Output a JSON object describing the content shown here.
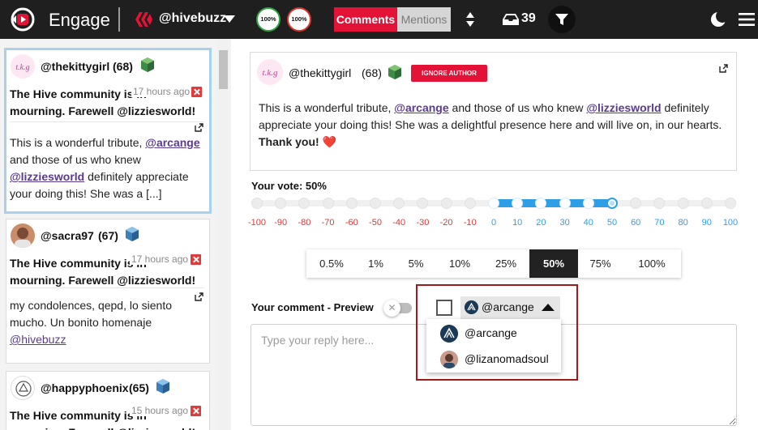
{
  "app": {
    "title": "Engage"
  },
  "header": {
    "account": "@hivebuzz",
    "voting_power": "100%",
    "resource_credits": "100%",
    "tabs": [
      {
        "label": "Comments",
        "active": true
      },
      {
        "label": "Mentions",
        "active": false
      }
    ],
    "inbox_count": "39",
    "icons": [
      "engage-logo-icon",
      "hive-logo-icon",
      "sort-icon",
      "inbox-icon",
      "filter-icon",
      "moon-icon",
      "menu-icon"
    ]
  },
  "colors": {
    "accent": "#e31337",
    "slider": "#2c9fe6",
    "topbar": "#1f1f1f",
    "selected_card_border": "#a8d2ec"
  },
  "cards": [
    {
      "author": "@thekittygirl",
      "rep": "(68)",
      "time": "17 hours ago",
      "title": "The Hive community is in mourning. Farewell @lizziesworld!",
      "body_1": "This is a wonderful tribute, ",
      "mention_1": "@arcange",
      "body_2": " and those of us who knew ",
      "mention_2": "@lizziesworld",
      "body_3": " definitely appreciate your doing this! She was a [...]"
    },
    {
      "author": "@sacra97",
      "rep": "(67)",
      "time": "17 hours ago",
      "title": "The Hive community is in mourning. Farewell @lizziesworld!",
      "body_1": "my condolences, qepd, lo siento mucho. Un bonito homenaje ",
      "mention_1": "@hivebuzz"
    },
    {
      "author": "@happyphoenix",
      "rep": "(65)",
      "time": "15 hours ago",
      "title": "The Hive community is in mourning. Farewell @lizziesworld!"
    }
  ],
  "post": {
    "author": "@thekittygirl",
    "rep": "(68)",
    "ignore_label": "IGNORE AUTHOR",
    "body_1": "This is a wonderful tribute, ",
    "mention_1": "@arcange",
    "body_2": " and those of us who knew ",
    "mention_2": "@lizziesworld",
    "body_3": " definitely appreciate your doing this! She was a delightful presence here and will live on, in our hearts. ",
    "body_bold": "Thank you!",
    "emoji": "❤️"
  },
  "vote": {
    "label": "Your vote: 50%",
    "value": 50,
    "ticks": [
      "-100",
      "-90",
      "-80",
      "-70",
      "-60",
      "-50",
      "-40",
      "-30",
      "-20",
      "-10",
      "0",
      "10",
      "20",
      "30",
      "40",
      "50",
      "60",
      "70",
      "80",
      "90",
      "100"
    ],
    "presets": [
      "0.5%",
      "1%",
      "5%",
      "10%",
      "25%",
      "50%",
      "75%",
      "100%"
    ],
    "active_preset": "50%"
  },
  "comment": {
    "label": "Your comment - Preview",
    "toggle_glyph": "✕",
    "placeholder": "Type your reply here..."
  },
  "mention_dropdown": {
    "selected": "@arcange",
    "options": [
      "@arcange",
      "@lizanomadsoul"
    ]
  }
}
